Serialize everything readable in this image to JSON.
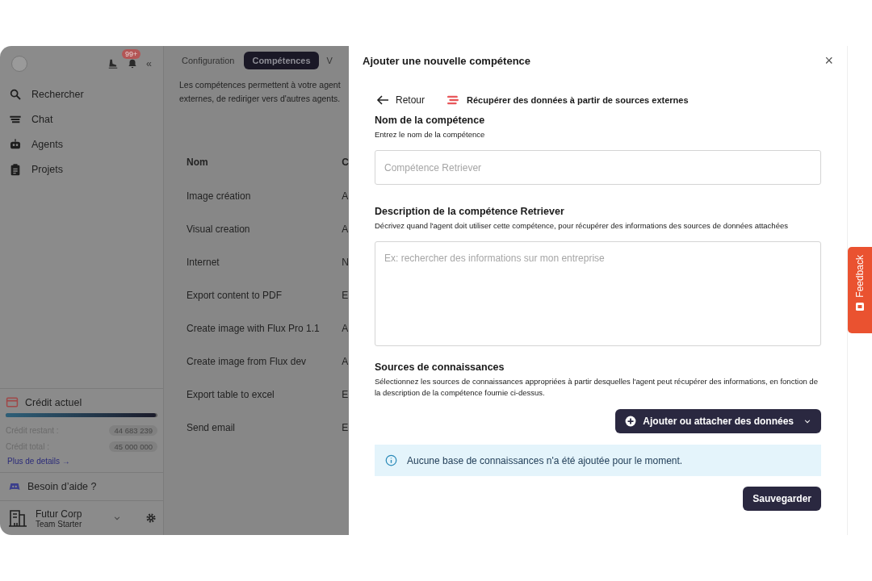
{
  "sidebar": {
    "notification_badge": "99+",
    "collapse_label": "«",
    "nav_items": [
      {
        "label": "Rechercher"
      },
      {
        "label": "Chat"
      },
      {
        "label": "Agents"
      },
      {
        "label": "Projets"
      }
    ],
    "credit": {
      "title": "Crédit actuel",
      "level": 0.99,
      "rows": [
        {
          "label": "Crédit restant :",
          "value": "44 683 239"
        },
        {
          "label": "Crédit total :",
          "value": "45 000 000"
        }
      ],
      "link": "Plus de details",
      "link_arrow": "→"
    },
    "help": "Besoin d’aide ?",
    "workspace": {
      "name": "Futur Corp",
      "plan": "Team Starter"
    }
  },
  "main": {
    "tabs": [
      {
        "label": "Configuration",
        "selected": false
      },
      {
        "label": "Compétences",
        "selected": true
      },
      {
        "label": "V",
        "selected": false
      }
    ],
    "description_lines": [
      "Les compétences permettent à votre agent",
      "externes, de rediriger vers d'autres agents."
    ],
    "table": {
      "columns": [
        "Nom",
        "C"
      ],
      "rows": [
        [
          "Image création",
          "A"
        ],
        [
          "Visual creation",
          "A"
        ],
        [
          "Internet",
          "N"
        ],
        [
          "Export content to PDF",
          "E"
        ],
        [
          "Create image with Flux Pro 1.1",
          "A"
        ],
        [
          "Create image from Flux dev",
          "A"
        ],
        [
          "Export table to excel",
          "E"
        ],
        [
          "Send email",
          "E"
        ]
      ]
    }
  },
  "dialog": {
    "title": "Ajouter une nouvelle compétence",
    "close_label": "×",
    "back_label": "Retour",
    "source_title": "Récupérer des données à partir de sources externes",
    "fields": [
      {
        "kind": "input",
        "label": "Nom de la compétence",
        "hint": "Entrez le nom de la compétence",
        "placeholder": "Compétence Retriever"
      },
      {
        "kind": "textarea",
        "label": "Description de la compétence Retriever",
        "hint": "Décrivez quand l'agent doit utiliser cette compétence, pour récupérer des informations des sources de données attachées",
        "placeholder": "Ex: rechercher des informations sur mon entreprise"
      }
    ],
    "sources": {
      "label": "Sources de connaissances",
      "hint": "Sélectionnez les sources de connaissances appropriées à partir desquelles l'agent peut récupérer des informations, en fonction de la description de la compétence fournie ci-dessus.",
      "button": "Ajouter ou attacher des données"
    },
    "info": "Aucune base de connaissances n'a été ajoutée pour le moment.",
    "save_button": "Sauvegarder"
  },
  "feedback_tab": {
    "label": "Feedback"
  }
}
